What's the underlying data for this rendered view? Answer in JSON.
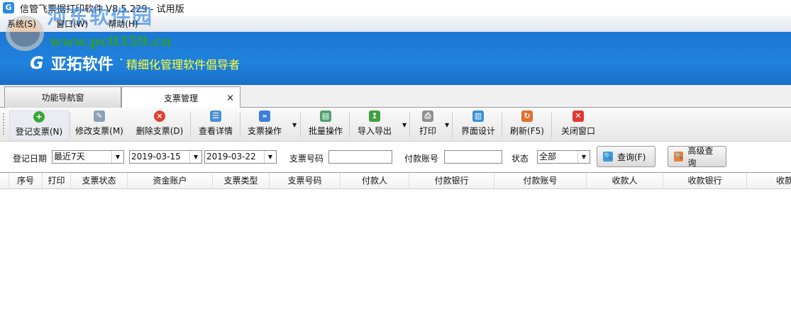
{
  "window": {
    "title": "信管飞票据打印软件 V8.5.229 - 试用版",
    "icon": "app-logo-icon"
  },
  "menu": [
    "系统(S)",
    "窗口(W)",
    "帮助(H)"
  ],
  "banner": {
    "brand": "亚拓软件",
    "slogan": "精细化管理软件倡导者"
  },
  "watermark": {
    "name": "河东软件园",
    "url": "www.pc0359.cn"
  },
  "tabs": [
    {
      "label": "功能导航窗"
    },
    {
      "label": "支票管理",
      "close": "×"
    }
  ],
  "toolbar": [
    {
      "label": "登记支票(N)",
      "icon": "plus-icon",
      "color": "#3aa63a"
    },
    {
      "label": "修改支票(M)",
      "icon": "edit-icon",
      "color": "#8aa0b8"
    },
    {
      "label": "删除支票(D)",
      "icon": "delete-icon",
      "color": "#e04030"
    },
    {
      "label": "查看详情",
      "icon": "details-icon",
      "color": "#4a90d0"
    },
    {
      "label": "支票操作",
      "icon": "double-chevron-icon",
      "color": "#3a80d8"
    },
    {
      "label": "批量操作",
      "icon": "batch-icon",
      "color": "#50a070"
    },
    {
      "label": "导入导出",
      "icon": "import-export-icon",
      "color": "#40a040"
    },
    {
      "label": "打印",
      "icon": "printer-icon",
      "color": "#909090"
    },
    {
      "label": "界面设计",
      "icon": "layout-icon",
      "color": "#3a90d8"
    },
    {
      "label": "刷新(F5)",
      "icon": "refresh-icon",
      "color": "#e07030"
    },
    {
      "label": "关闭窗口",
      "icon": "close-window-icon",
      "color": "#e03a30"
    }
  ],
  "filter": {
    "date_label": "登记日期",
    "date_range": "最近7天",
    "start_date": "2019-03-15",
    "end_date": "2019-03-22",
    "cheque_no_label": "支票号码",
    "cheque_no_value": "",
    "payer_account_label": "付款账号",
    "payer_account_value": "",
    "status_label": "状态",
    "status_value": "全部",
    "query_button": "查询(F)",
    "advanced_button": "高级查询"
  },
  "table": {
    "columns": [
      "序号",
      "打印",
      "支票状态",
      "资金账户",
      "支票类型",
      "支票号码",
      "付款人",
      "付款银行",
      "付款账号",
      "收款人",
      "收款银行",
      "收款"
    ],
    "rows": []
  }
}
